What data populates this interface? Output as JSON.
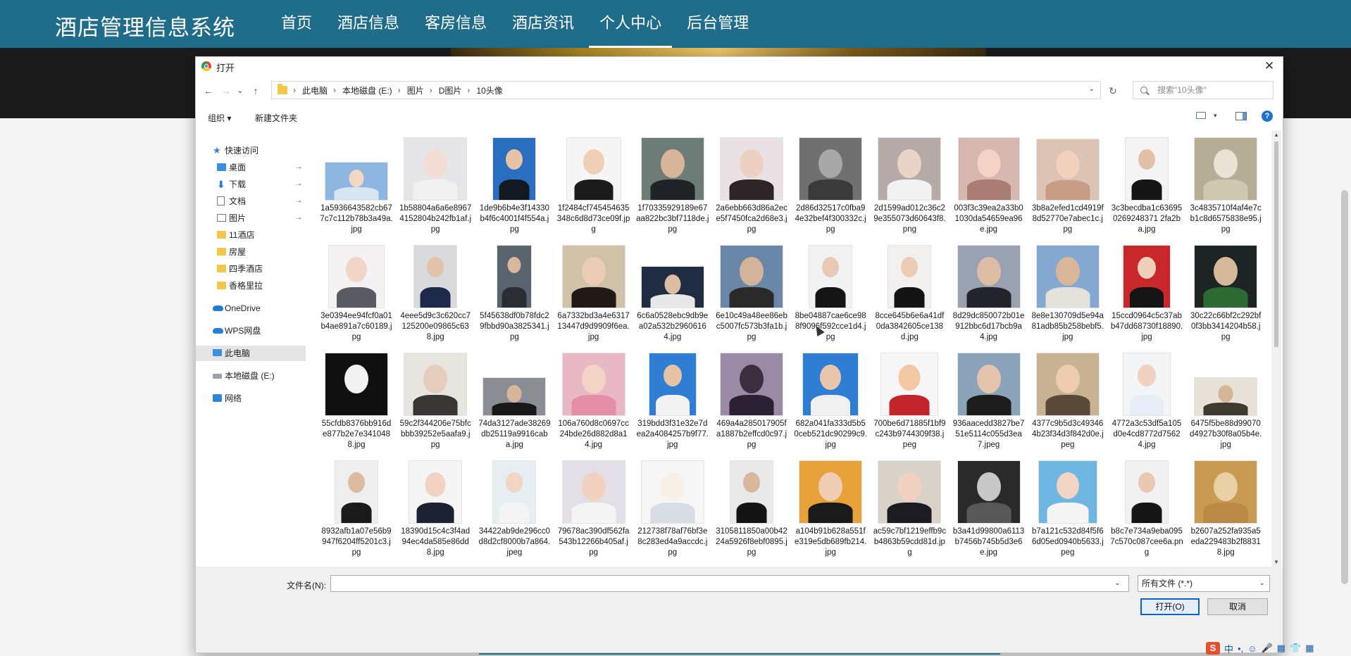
{
  "site": {
    "logo": "酒店管理信息系统",
    "menu": [
      "首页",
      "酒店信息",
      "客房信息",
      "酒店资讯",
      "个人中心",
      "后台管理"
    ],
    "active_menu": "个人中心"
  },
  "dialog": {
    "title": "打开",
    "close_symbol": "✕",
    "nav": {
      "back": "←",
      "forward": "→",
      "recent": "⌄",
      "up": "↑",
      "refresh": "↻",
      "dropdown": "⌄"
    },
    "breadcrumb": [
      "此电脑",
      "本地磁盘 (E:)",
      "图片",
      "D图片",
      "10头像"
    ],
    "breadcrumb_sep": "›",
    "search_placeholder": "搜索\"10头像\"",
    "toolbar": {
      "organize": "组织 ▾",
      "new_folder": "新建文件夹",
      "view_caret": "▾",
      "help": "?"
    },
    "sidebar": [
      {
        "label": "快速访问",
        "icon": "star-icon",
        "indent": 0,
        "pinned": false
      },
      {
        "label": "桌面",
        "icon": "desktop-icon",
        "indent": 1,
        "pinned": true
      },
      {
        "label": "下载",
        "icon": "download-icon",
        "indent": 1,
        "pinned": true
      },
      {
        "label": "文档",
        "icon": "document-icon",
        "indent": 1,
        "pinned": true
      },
      {
        "label": "图片",
        "icon": "pictures-icon",
        "indent": 1,
        "pinned": true
      },
      {
        "label": "11酒店",
        "icon": "folder-icon",
        "indent": 1,
        "pinned": false
      },
      {
        "label": "房屋",
        "icon": "folder-icon",
        "indent": 1,
        "pinned": false
      },
      {
        "label": "四季酒店",
        "icon": "folder-icon",
        "indent": 1,
        "pinned": false
      },
      {
        "label": "香格里拉",
        "icon": "folder-icon",
        "indent": 1,
        "pinned": false
      },
      {
        "label": "OneDrive",
        "icon": "cloud-icon",
        "indent": 0,
        "pinned": false
      },
      {
        "label": "WPS网盘",
        "icon": "wps-cloud-icon",
        "indent": 0,
        "pinned": false
      },
      {
        "label": "此电脑",
        "icon": "computer-icon",
        "indent": 0,
        "pinned": false,
        "selected": true
      },
      {
        "label": "本地磁盘 (E:)",
        "icon": "drive-icon",
        "indent": 0,
        "pinned": false
      },
      {
        "label": "网络",
        "icon": "network-icon",
        "indent": 0,
        "pinned": false
      }
    ],
    "pin_symbol": "📌",
    "files": [
      {
        "name": "1a5936643582cb677c7c112b78b3a49a.jpg",
        "bg": "#8fb6e0",
        "skin": "#f3d6c4",
        "cloth": "#d8e6f3"
      },
      {
        "name": "1b58804a6a6e89674152804b242fb1af.jpg",
        "bg": "#e6e6e8",
        "skin": "#f1ddd3",
        "cloth": "#f0f0f0"
      },
      {
        "name": "1de9b6b4e3f14330b4f6c4001f4f554a.jpg",
        "bg": "#2a6fbf",
        "skin": "#e6c3a7",
        "cloth": "#141820"
      },
      {
        "name": "1f2484cf745454635348c6d8d73ce09f.jpg",
        "bg": "#f5f5f5",
        "skin": "#efcfb5",
        "cloth": "#1b1b1b"
      },
      {
        "name": "1f70335929189e67aa822bc3bf7118de.jpg",
        "bg": "#6e7c77",
        "skin": "#d7b49a",
        "cloth": "#202327"
      },
      {
        "name": "2a6ebb663d86a2ece5f7450fca2d68e3.jpg",
        "bg": "#e8e2e4",
        "skin": "#ecd0c1",
        "cloth": "#2c2426"
      },
      {
        "name": "2d86d32517c0fba94e32bef4f300332c.jpg",
        "bg": "#707070",
        "skin": "#a8a8a8",
        "cloth": "#3a3a3a"
      },
      {
        "name": "2d1599ad012c36c29e355073d60643f8.png",
        "bg": "#b5aaa8",
        "skin": "#ead3c9",
        "cloth": "#f2f2f2"
      },
      {
        "name": "003f3c39ea2a33b01030da54659ea96e.jpg",
        "bg": "#d7b8b0",
        "skin": "#f4d3c6",
        "cloth": "#a97d74"
      },
      {
        "name": "3b8a2efed1cd4919f8d52770e7abec1c.jpg",
        "bg": "#dcc4b5",
        "skin": "#f2d1bd",
        "cloth": "#c79e85"
      },
      {
        "name": "3c3becdba1c636950269248371 2fa2ba.jpg",
        "bg": "#f4f4f4",
        "skin": "#e3c1a8",
        "cloth": "#161616"
      },
      {
        "name": "3c4835710f4af4e7cb1c8d6575838e95.jpg",
        "bg": "#b5ad95",
        "skin": "#e9e2d6",
        "cloth": "#d0c7b0"
      },
      {
        "name": "3e0394ee94fcf0a01b4ae891a7c60189.jpg",
        "bg": "#f4f2f2",
        "skin": "#f1d5c7",
        "cloth": "#5a5a62"
      },
      {
        "name": "4eee5d9c3c620cc7125200e09865c638.jpg",
        "bg": "#d8dadc",
        "skin": "#e2c2a8",
        "cloth": "#1d2a4a"
      },
      {
        "name": "5f45638df0b78fdc29fbbd90a3825341.jpg",
        "bg": "#5a646e",
        "skin": "#d7b79d",
        "cloth": "#2a2d33"
      },
      {
        "name": "6a7332bd3a4e631713447d9d9909f6ea.jpg",
        "bg": "#cfc2a8",
        "skin": "#eacbb4",
        "cloth": "#1f1a16"
      },
      {
        "name": "6c6a0528ebc9db9ea02a532b29606164.jpg",
        "bg": "#1f2c42",
        "skin": "#dcbca2",
        "cloth": "#e8e8e8"
      },
      {
        "name": "6e10c49a48ee86ebc5007fc573b3fa1b.jpg",
        "bg": "#6a87a8",
        "skin": "#d3b49a",
        "cloth": "#2a2a2a"
      },
      {
        "name": "8be04887cae6ce988f9096f592cce1d4.jpg",
        "bg": "#f2f2f2",
        "skin": "#e8c9b3",
        "cloth": "#151515"
      },
      {
        "name": "8cce645b6e6a41df0da3842605ce138d.jpg",
        "bg": "#f2f0ef",
        "skin": "#eccbb5",
        "cloth": "#141414"
      },
      {
        "name": "8d29dc850072b01e912bbc6d17bcb9a4.jpg",
        "bg": "#9aa2b2",
        "skin": "#dcbca5",
        "cloth": "#24252b"
      },
      {
        "name": "8e8e130709d5e94a81adb85b258bebf5.jpg",
        "bg": "#84a8cf",
        "skin": "#d9b59b",
        "cloth": "#e3e1dc"
      },
      {
        "name": "15ccd0964c5c37abb47dd68730f18890.jpg",
        "bg": "#c8272c",
        "skin": "#f0d0ba",
        "cloth": "#151515"
      },
      {
        "name": "30c22c66bf2c292bf0f3bb3414204b58.jpg",
        "bg": "#1e2424",
        "skin": "#d6b89a",
        "cloth": "#2e6b34"
      },
      {
        "name": "55cfdb8376bb916de877b2e7e3410488.jpg",
        "bg": "#101010",
        "skin": "#f2f2f2",
        "cloth": "#101010"
      },
      {
        "name": "59c2f344206e75bfcbbb39252e5aafa9.jpg",
        "bg": "#e8e4e0",
        "skin": "#e4cdbd",
        "cloth": "#3a3534"
      },
      {
        "name": "74da3127ade38269db25119a9916caba.jpg",
        "bg": "#8a8e94",
        "skin": "#d6b59d",
        "cloth": "#181818"
      },
      {
        "name": "106a760d8c0697cc24bde26d882d8a14.jpg",
        "bg": "#e8b9c4",
        "skin": "#f2d3c6",
        "cloth": "#e58fa7"
      },
      {
        "name": "319bdd3f31e32e7dea2a4084257b9f77.jpg",
        "bg": "#2f7ed3",
        "skin": "#e6c3a7",
        "cloth": "#f2f2f2"
      },
      {
        "name": "469a4a285017905fa1887b2effcd0c97.jpg",
        "bg": "#9a8aa6",
        "skin": "#3a3040",
        "cloth": "#2a2232"
      },
      {
        "name": "682a041fa333d5b50ceb521dc90299c9.jpg",
        "bg": "#2f7ed3",
        "skin": "#e8c6ab",
        "cloth": "#f0f0f0"
      },
      {
        "name": "700be6d71885f1bf9c243b9744309f38.jpeg",
        "bg": "#f6f6f6",
        "skin": "#f1c7a4",
        "cloth": "#c2252b"
      },
      {
        "name": "936aacedd3827be751e5114c055d3ea7.jpeg",
        "bg": "#8aa3b8",
        "skin": "#e3c4ad",
        "cloth": "#1c1c1c"
      },
      {
        "name": "4377c9b5d3c493464b23f34d3f842d0e.jpeg",
        "bg": "#c7b393",
        "skin": "#eccbb0",
        "cloth": "#5a4938"
      },
      {
        "name": "4772a3c53df5a105d0e4cd8772d75624.jpg",
        "bg": "#f2f4f6",
        "skin": "#f0d2c1",
        "cloth": "#e7edf5"
      },
      {
        "name": "6475f5be88d99070d4927b30f8a05b4e.jpg",
        "bg": "#e7e2d8",
        "skin": "#d7b598",
        "cloth": "#3e3a32"
      },
      {
        "name": "8932afb1a07e56b9947f6204ff5201c3.jpg",
        "bg": "#eeeeee",
        "skin": "#dcbba1",
        "cloth": "#1a1a1a"
      },
      {
        "name": "18390d15c4c3f4ad94ec4da585e86dd8.jpg",
        "bg": "#f5f5f5",
        "skin": "#f2d3c3",
        "cloth": "#1d2233"
      },
      {
        "name": "34422ab9de296cc0d8d2cf8000b7a864.jpeg",
        "bg": "#e6eef1",
        "skin": "#f0d4c4",
        "cloth": "#f4f4f4"
      },
      {
        "name": "79678ac390df562fa543b12266b405af.jpg",
        "bg": "#e4dfe6",
        "skin": "#f1d2c0",
        "cloth": "#f4f4f4"
      },
      {
        "name": "212738f78af76bf3e8c283ed4a9accdc.jpg",
        "bg": "#f6f6f6",
        "skin": "#f7f0e8",
        "cloth": "#d8dde3"
      },
      {
        "name": "3105811850a00b4224a5926f8ebf0895.jpg",
        "bg": "#e9e9e9",
        "skin": "#d9b79e",
        "cloth": "#141414"
      },
      {
        "name": "a104b91b628a551fe319e5db689fb214.jpg",
        "bg": "#e8a23a",
        "skin": "#f0cdb3",
        "cloth": "#1a1a1a"
      },
      {
        "name": "ac59c7bf1219effb9cb4863b59cdd81d.jpg",
        "bg": "#d9d2c8",
        "skin": "#f1d2c0",
        "cloth": "#1c1c22"
      },
      {
        "name": "b3a41d99800a6113b7456b745b5d3e6e.jpg",
        "bg": "#2a2a2a",
        "skin": "#c8c8c8",
        "cloth": "#585858"
      },
      {
        "name": "b7a121c532d84f5f66d05ed0940b5633.jpeg",
        "bg": "#6fb6e3",
        "skin": "#f1d4c4",
        "cloth": "#f4f4f4"
      },
      {
        "name": "b8c7e734a9eba0957c570c087cee6a.png",
        "bg": "#f1f1f1",
        "skin": "#e9c8b2",
        "cloth": "#161616"
      },
      {
        "name": "b2607a252fa935a5eda229483b2f88318.jpg",
        "bg": "#c89a52",
        "skin": "#e7cfa6",
        "cloth": "#b98a45"
      },
      {
        "name": "",
        "bg": "#e8e4e2",
        "skin": "#202020",
        "cloth": "#1a1a1a"
      },
      {
        "name": "",
        "bg": "#eae2e2",
        "skin": "#f2d3c4",
        "cloth": "#efe4df"
      },
      {
        "name": "",
        "bg": "#f2efee",
        "skin": "#f1d2c1",
        "cloth": "#222"
      },
      {
        "name": "",
        "bg": "#f5f3f3",
        "skin": "#f1d3c4",
        "cloth": "#333"
      },
      {
        "name": "",
        "bg": "#c9812e",
        "skin": "#e8c48f",
        "cloth": "#8a5422"
      },
      {
        "name": "",
        "bg": "#2a2a2a",
        "skin": "#e8c6ae",
        "cloth": "#111"
      },
      {
        "name": "",
        "bg": "#e0c6a8",
        "skin": "#f1d4c0",
        "cloth": "#c49b7d"
      },
      {
        "name": "",
        "bg": "#ffffff",
        "skin": "#1a1a1a",
        "cloth": "#1a1a1a"
      },
      {
        "name": "",
        "bg": "#22324e",
        "skin": "#e6c8b0",
        "cloth": "#31425e"
      },
      {
        "name": "",
        "bg": "#c97a57",
        "skin": "#f0d2bf",
        "cloth": "#b35a38"
      },
      {
        "name": "",
        "bg": "#1d5fa8",
        "skin": "#3a7fc4",
        "cloth": "#0e3d78"
      },
      {
        "name": "",
        "bg": "#f2f2f2",
        "skin": "#1b2238",
        "cloth": "#1b2238"
      }
    ],
    "filename_label": "文件名(N):",
    "filename_value": "",
    "filetype_value": "所有文件 (*.*)",
    "open_button": "打开(O)",
    "cancel_button": "取消"
  },
  "ime": {
    "logo": "S",
    "glyphs": [
      "中",
      "•,",
      "☺",
      "🎤",
      "▦",
      "👕",
      "▦"
    ]
  },
  "colors": {
    "nav_bg": "#1f6d8a",
    "accent_blue": "#0a64c8"
  }
}
